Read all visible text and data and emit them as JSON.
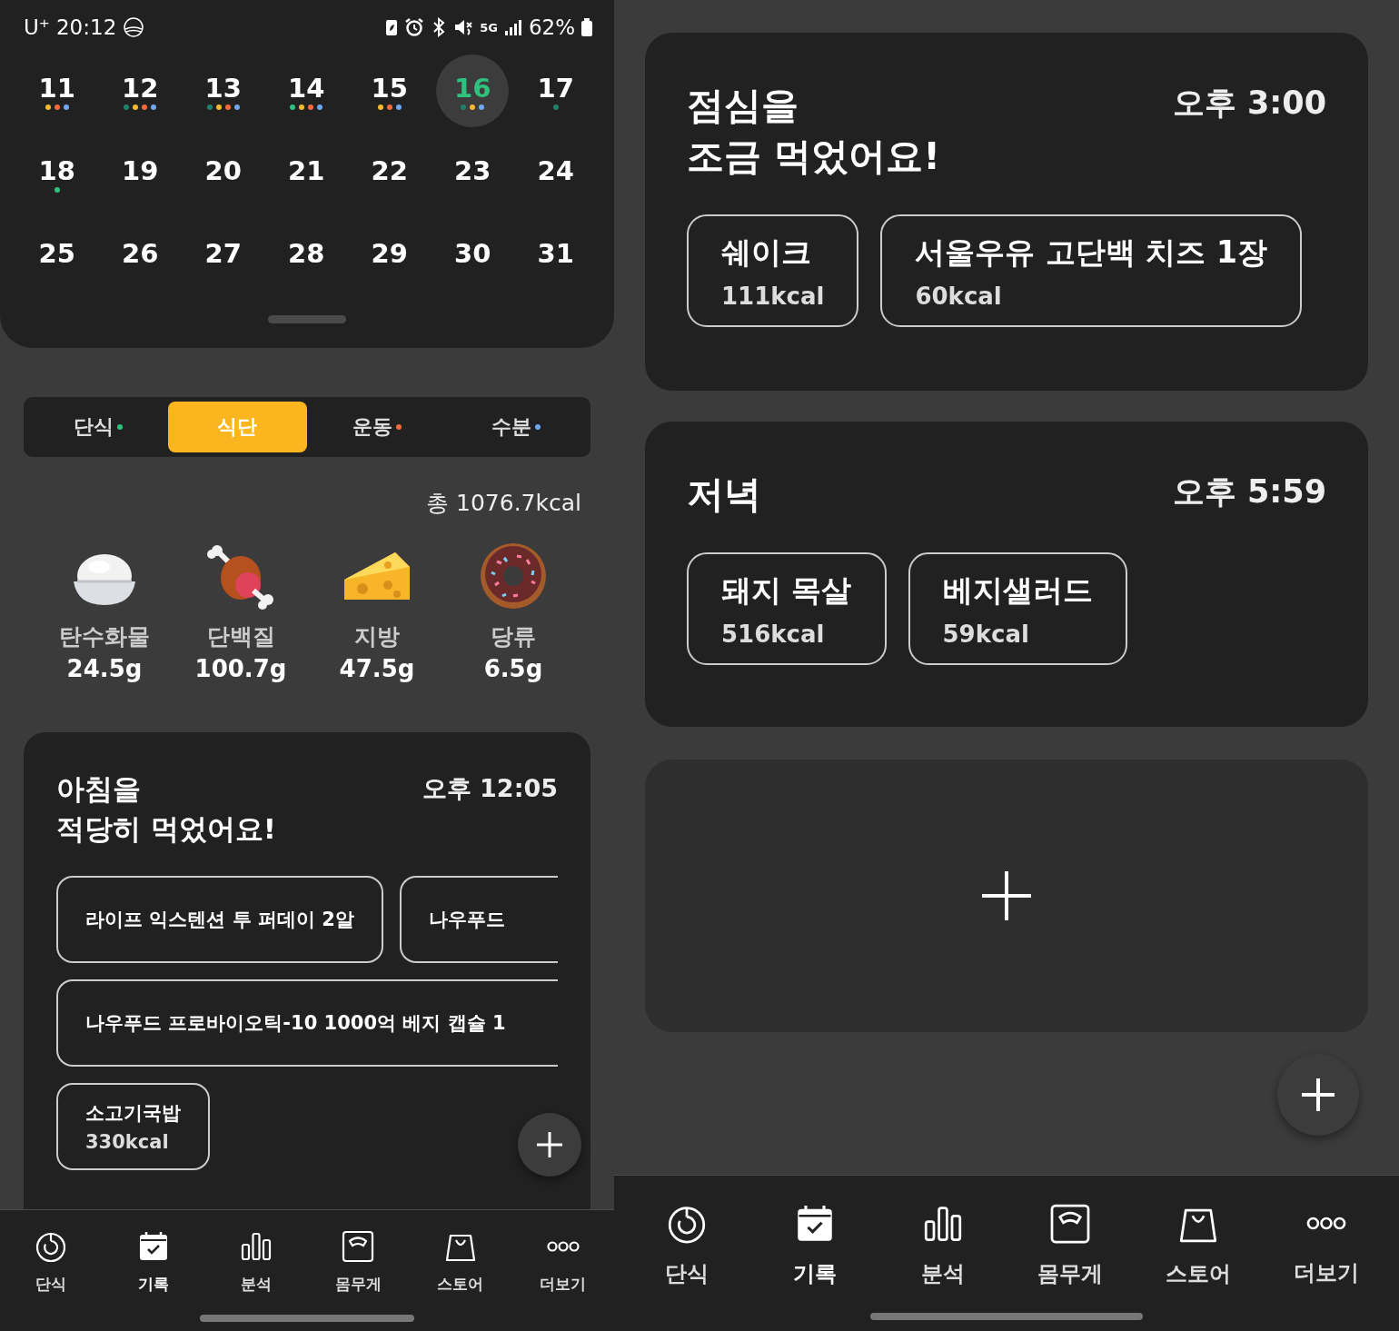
{
  "left_screen": {
    "status_bar": {
      "carrier": "U⁺",
      "time": "20:12",
      "network": "5G",
      "battery": "62%"
    },
    "calendar": {
      "weeks": [
        [
          {
            "day": "11",
            "selected": false,
            "dots": [
              {
                "color": "#f5b82e"
              },
              {
                "color": "#f26b3a"
              },
              {
                "color": "#6fa8f0"
              }
            ]
          },
          {
            "day": "12",
            "selected": false,
            "dots": [
              {
                "color": "#21806b"
              },
              {
                "color": "#f5b82e"
              },
              {
                "color": "#f26b3a"
              },
              {
                "color": "#6fa8f0"
              }
            ]
          },
          {
            "day": "13",
            "selected": false,
            "dots": [
              {
                "color": "#21806b"
              },
              {
                "color": "#f5b82e"
              },
              {
                "color": "#f26b3a"
              },
              {
                "color": "#6fa8f0"
              }
            ]
          },
          {
            "day": "14",
            "selected": false,
            "dots": [
              {
                "color": "#2ec27e"
              },
              {
                "color": "#f5b82e"
              },
              {
                "color": "#f26b3a"
              },
              {
                "color": "#6fa8f0"
              }
            ]
          },
          {
            "day": "15",
            "selected": false,
            "dots": [
              {
                "color": "#f5b82e"
              },
              {
                "color": "#f26b3a"
              },
              {
                "color": "#6fa8f0"
              }
            ]
          },
          {
            "day": "16",
            "selected": true,
            "dots": [
              {
                "color": "#21806b"
              },
              {
                "color": "#f5b82e"
              },
              {
                "color": "#6fa8f0"
              }
            ]
          },
          {
            "day": "17",
            "selected": false,
            "dots": [
              {
                "color": "#21806b"
              }
            ]
          }
        ],
        [
          {
            "day": "18",
            "selected": false,
            "dots": [
              {
                "color": "#2ec27e"
              }
            ]
          },
          {
            "day": "19",
            "selected": false
          },
          {
            "day": "20",
            "selected": false
          },
          {
            "day": "21",
            "selected": false
          },
          {
            "day": "22",
            "selected": false
          },
          {
            "day": "23",
            "selected": false
          },
          {
            "day": "24",
            "selected": false
          }
        ],
        [
          {
            "day": "25",
            "selected": false
          },
          {
            "day": "26",
            "selected": false
          },
          {
            "day": "27",
            "selected": false
          },
          {
            "day": "28",
            "selected": false
          },
          {
            "day": "29",
            "selected": false
          },
          {
            "day": "30",
            "selected": false
          },
          {
            "day": "31",
            "selected": false
          }
        ]
      ]
    },
    "tabs": [
      {
        "label": "단식",
        "selected": false,
        "color": "#2ec27e"
      },
      {
        "label": "식단",
        "selected": true
      },
      {
        "label": "운동",
        "selected": false,
        "color": "#f26b3a"
      },
      {
        "label": "수분",
        "selected": false,
        "color": "#6fa8f0"
      }
    ],
    "total": "총 1076.7kcal",
    "nutrients": [
      {
        "kind": "rice",
        "name": "탄수화물",
        "amount": "24.5g"
      },
      {
        "kind": "meat",
        "name": "단백질",
        "amount": "100.7g"
      },
      {
        "kind": "cheese",
        "name": "지방",
        "amount": "47.5g"
      },
      {
        "kind": "donut",
        "name": "당류",
        "amount": "6.5g"
      }
    ],
    "meal": {
      "title": [
        "아침을",
        "적당히 먹었어요!"
      ],
      "time": "오후 12:05",
      "rows": [
        [
          {
            "name": "라이프 익스텐션 투 퍼데이 2알",
            "cut": false
          },
          {
            "name": "나우푸드",
            "cut": true
          }
        ],
        [
          {
            "name": "나우푸드 프로바이오틱-10 1000억 베지 캡슐 1",
            "cut": true
          }
        ],
        [
          {
            "name": "소고기국밥",
            "kcal": "330kcal",
            "cut": false
          }
        ]
      ]
    },
    "nav": [
      {
        "kind": "timer",
        "label": "단식",
        "selected": false
      },
      {
        "kind": "calendar",
        "label": "기록",
        "selected": true
      },
      {
        "kind": "chart",
        "label": "분석",
        "selected": false
      },
      {
        "kind": "scale",
        "label": "몸무게",
        "selected": false
      },
      {
        "kind": "bag",
        "label": "스토어",
        "selected": false
      },
      {
        "kind": "more",
        "label": "더보기",
        "selected": false
      }
    ]
  },
  "right_screen": {
    "meals": [
      {
        "title": [
          "점심을",
          "조금 먹었어요!"
        ],
        "time": "오후 3:00",
        "rows": [
          [
            {
              "name": "쉐이크",
              "kcal": "111kcal",
              "cut": false
            },
            {
              "name": "서울우유 고단백 치즈 1장",
              "kcal": "60kcal",
              "cut": false
            }
          ]
        ]
      },
      {
        "title": [
          "저녁"
        ],
        "time": "오후 5:59",
        "rows": [
          [
            {
              "name": "돼지 목살",
              "kcal": "516kcal",
              "cut": false
            },
            {
              "name": "베지샐러드",
              "kcal": "59kcal",
              "cut": false
            }
          ]
        ]
      }
    ],
    "nav": [
      {
        "kind": "timer",
        "label": "단식",
        "selected": false
      },
      {
        "kind": "calendar",
        "label": "기록",
        "selected": true
      },
      {
        "kind": "chart",
        "label": "분석",
        "selected": false
      },
      {
        "kind": "scale",
        "label": "몸무게",
        "selected": false
      },
      {
        "kind": "bag",
        "label": "스토어",
        "selected": false
      },
      {
        "kind": "more",
        "label": "더보기",
        "selected": false
      }
    ]
  }
}
